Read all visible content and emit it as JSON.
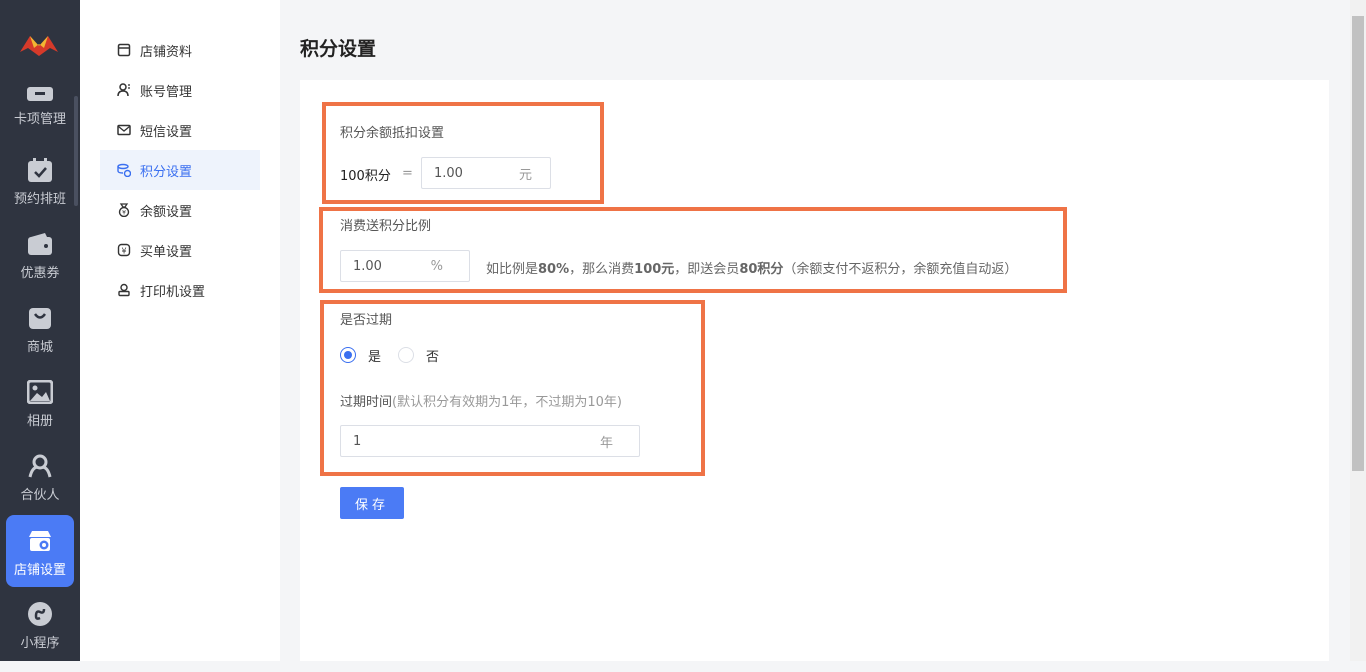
{
  "rail": {
    "items": [
      {
        "label": "卡项管理",
        "icon": "card-icon"
      },
      {
        "label": "预约排班",
        "icon": "calendar-icon"
      },
      {
        "label": "优惠券",
        "icon": "wallet-icon"
      },
      {
        "label": "商城",
        "icon": "shopping-bag-icon"
      },
      {
        "label": "相册",
        "icon": "image-icon"
      },
      {
        "label": "合伙人",
        "icon": "partner-icon"
      },
      {
        "label": "店铺设置",
        "icon": "store-settings-icon"
      },
      {
        "label": "小程序",
        "icon": "miniprogram-icon"
      }
    ]
  },
  "submenu": {
    "items": [
      {
        "label": "店铺资料",
        "icon": "store-icon"
      },
      {
        "label": "账号管理",
        "icon": "user-icon"
      },
      {
        "label": "短信设置",
        "icon": "mail-icon"
      },
      {
        "label": "积分设置",
        "icon": "points-icon"
      },
      {
        "label": "余额设置",
        "icon": "money-bag-icon"
      },
      {
        "label": "买单设置",
        "icon": "yuan-icon"
      },
      {
        "label": "打印机设置",
        "icon": "printer-icon"
      }
    ]
  },
  "page": {
    "title": "积分设置"
  },
  "deduct": {
    "section_label": "积分余额抵扣设置",
    "points_label": "100积分",
    "equals": "=",
    "value": "1.00",
    "unit": "元"
  },
  "ratio": {
    "section_label": "消费送积分比例",
    "value": "1.00",
    "unit": "%",
    "hint_prefix": "如比例是",
    "hint_pct": "80%",
    "hint_mid": "，那么消费",
    "hint_amount": "100元",
    "hint_mid2": "，即送会员",
    "hint_points": "80积分",
    "hint_suffix": "（余额支付不返积分，余额充值自动返）"
  },
  "expire": {
    "section_label": "是否过期",
    "option_yes": "是",
    "option_no": "否",
    "selected": "是",
    "time_label": "过期时间",
    "time_hint": "(默认积分有效期为1年，不过期为10年)",
    "value": "1",
    "unit": "年"
  },
  "actions": {
    "save_label": "保存"
  },
  "colors": {
    "accent": "#4b7bf5",
    "highlight": "#ef7346",
    "rail_bg": "#2f3440"
  }
}
